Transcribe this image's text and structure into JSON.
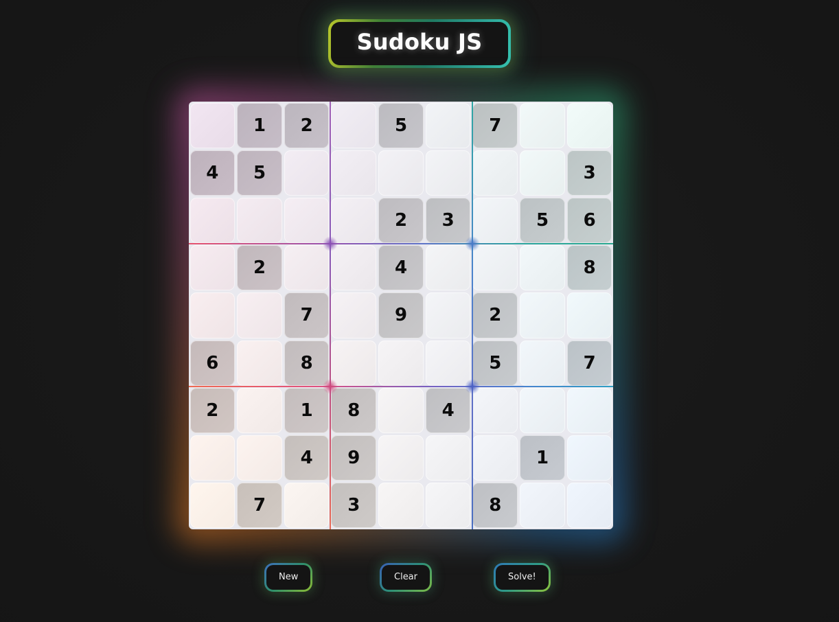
{
  "app": {
    "title": "Sudoku JS",
    "background_color": "#191919"
  },
  "board": {
    "size": 9,
    "box_size": 3,
    "rows": [
      [
        null,
        1,
        2,
        null,
        5,
        null,
        7,
        null,
        null
      ],
      [
        4,
        5,
        null,
        null,
        null,
        null,
        null,
        null,
        3
      ],
      [
        null,
        null,
        null,
        null,
        2,
        3,
        null,
        5,
        6
      ],
      [
        null,
        2,
        null,
        null,
        4,
        null,
        null,
        null,
        8
      ],
      [
        null,
        null,
        7,
        null,
        9,
        null,
        2,
        null,
        null
      ],
      [
        6,
        null,
        8,
        null,
        null,
        null,
        5,
        null,
        7
      ],
      [
        2,
        null,
        1,
        8,
        null,
        4,
        null,
        null,
        null
      ],
      [
        null,
        null,
        4,
        9,
        null,
        null,
        null,
        1,
        null
      ],
      [
        null,
        7,
        null,
        3,
        null,
        null,
        8,
        null,
        null
      ]
    ]
  },
  "controls": {
    "buttons": [
      {
        "id": "new",
        "label": "New"
      },
      {
        "id": "clear",
        "label": "Clear"
      },
      {
        "id": "solve",
        "label": "Solve!"
      }
    ]
  },
  "theme": {
    "glow_top_left": "#c454a0",
    "glow_top_right": "#2ea878",
    "glow_bottom_left": "#d67426",
    "glow_bottom_right": "#287cc4",
    "title_glow_start": "#b9c72b",
    "title_glow_end": "#36c2b0",
    "filled_cell_text": "#0b0b0b"
  }
}
